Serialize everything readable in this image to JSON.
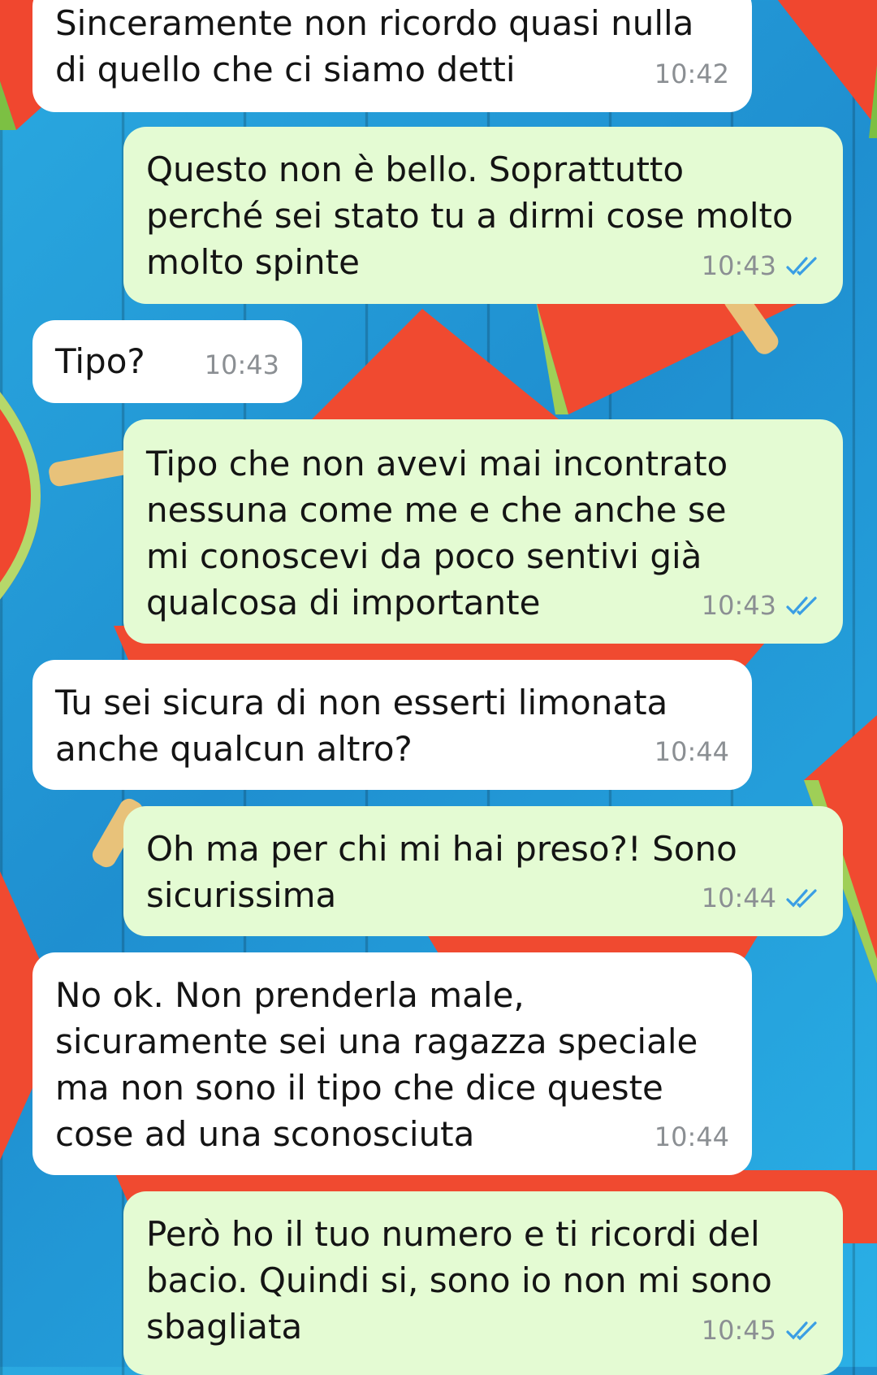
{
  "colors": {
    "incoming_bubble": "#ffffff",
    "outgoing_bubble": "#e4fbd3",
    "timestamp": "#8b8f93",
    "read_tick": "#3a9ee4",
    "wallpaper_blue": "#1f8fd0",
    "wallpaper_melon": "#f0472f"
  },
  "wallpaper": "watermelon-slices-on-blue-planks",
  "messages": [
    {
      "direction": "incoming",
      "text": "Sinceramente non ricordo quasi nulla\ndi quello che ci siamo detti",
      "time": "10:42"
    },
    {
      "direction": "outgoing",
      "text": "Questo non è bello. Soprattutto\nperché sei stato tu a dirmi cose molto\nmolto spinte",
      "time": "10:43",
      "status": "read-double-tick-icon"
    },
    {
      "direction": "incoming",
      "text": "Tipo?",
      "time": "10:43"
    },
    {
      "direction": "outgoing",
      "text": "Tipo che non avevi mai incontrato\nnessuna come me e che anche se\nmi conoscevi da poco sentivi già\nqualcosa di importante",
      "time": "10:43",
      "status": "read-double-tick-icon"
    },
    {
      "direction": "incoming",
      "text": "Tu sei sicura di non esserti limonata\nanche qualcun altro?",
      "time": "10:44"
    },
    {
      "direction": "outgoing",
      "text": "Oh ma per chi mi hai preso?! Sono\nsicurissima",
      "time": "10:44",
      "status": "read-double-tick-icon"
    },
    {
      "direction": "incoming",
      "text": "No ok. Non prenderla male,\nsicuramente sei una ragazza speciale\nma non sono il tipo che dice queste\ncose ad una sconosciuta",
      "time": "10:44"
    },
    {
      "direction": "outgoing",
      "text": "Però ho il tuo numero e ti ricordi del\nbacio. Quindi si, sono io non mi sono\nsbagliata",
      "time": "10:45",
      "status": "read-double-tick-icon"
    }
  ]
}
